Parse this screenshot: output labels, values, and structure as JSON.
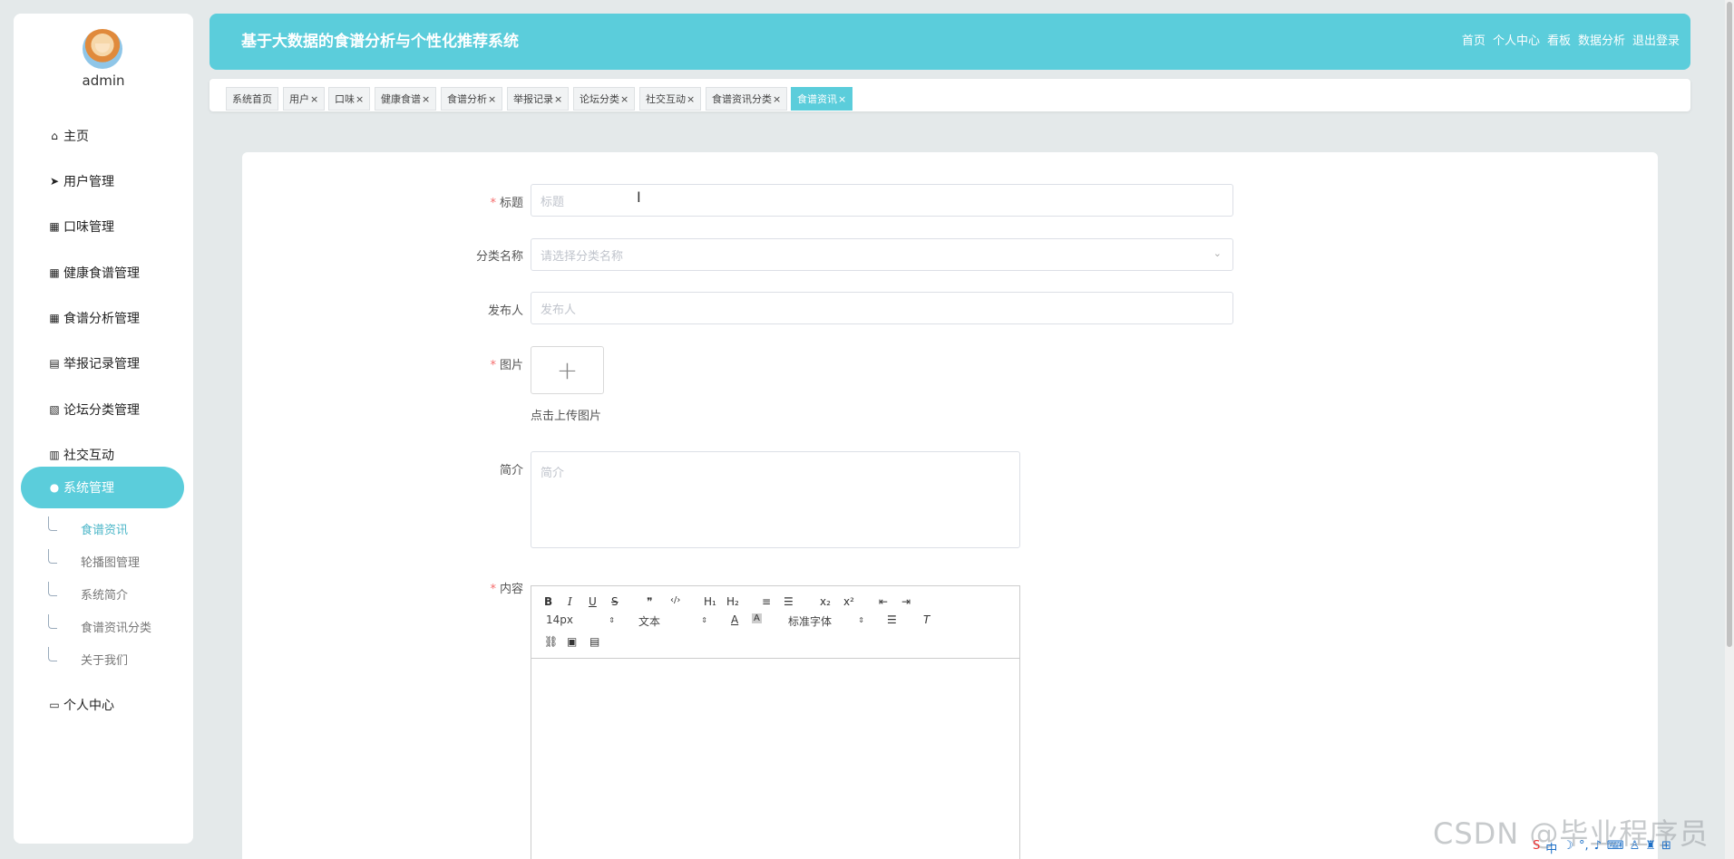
{
  "user": {
    "name": "admin"
  },
  "header": {
    "title": "基于大数据的食谱分析与个性化推荐系统",
    "nav": [
      "首页",
      "个人中心",
      "看板",
      "数据分析",
      "退出登录"
    ]
  },
  "sidebar": {
    "items": [
      {
        "label": "主页",
        "icon": "home-icon"
      },
      {
        "label": "用户管理",
        "icon": "paper-plane-icon"
      },
      {
        "label": "口味管理",
        "icon": "grid-icon"
      },
      {
        "label": "健康食谱管理",
        "icon": "grid-icon"
      },
      {
        "label": "食谱分析管理",
        "icon": "grid-icon"
      },
      {
        "label": "举报记录管理",
        "icon": "clipboard-icon"
      },
      {
        "label": "论坛分类管理",
        "icon": "clipboard-x-icon"
      },
      {
        "label": "社交互动",
        "icon": "books-icon"
      },
      {
        "label": "系统管理",
        "icon": "user-icon"
      },
      {
        "label": "个人中心",
        "icon": "wallet-icon"
      }
    ],
    "subitems": [
      "食谱资讯",
      "轮播图管理",
      "系统简介",
      "食谱资讯分类",
      "关于我们"
    ]
  },
  "tabs": [
    "系统首页",
    "用户",
    "口味",
    "健康食谱",
    "食谱分析",
    "举报记录",
    "论坛分类",
    "社交互动",
    "食谱资讯分类",
    "食谱资讯"
  ],
  "form": {
    "title_label": "标题",
    "title_placeholder": "标题",
    "category_label": "分类名称",
    "category_placeholder": "请选择分类名称",
    "publisher_label": "发布人",
    "publisher_placeholder": "发布人",
    "image_label": "图片",
    "upload_hint": "点击上传图片",
    "intro_label": "简介",
    "intro_placeholder": "简介",
    "content_label": "内容"
  },
  "editor": {
    "font_size": "14px",
    "header_style": "文本",
    "font_family": "标准字体",
    "buttons": [
      "B",
      "I",
      "U",
      "S",
      "❞",
      "‹/›",
      "H₁",
      "H₂",
      "≡",
      "☰",
      "x₂",
      "x²",
      "⇤",
      "⇥"
    ]
  },
  "watermark": "CSDN @毕业程序员",
  "colors": {
    "accent": "#5bcddb",
    "required": "#f56c6c"
  }
}
